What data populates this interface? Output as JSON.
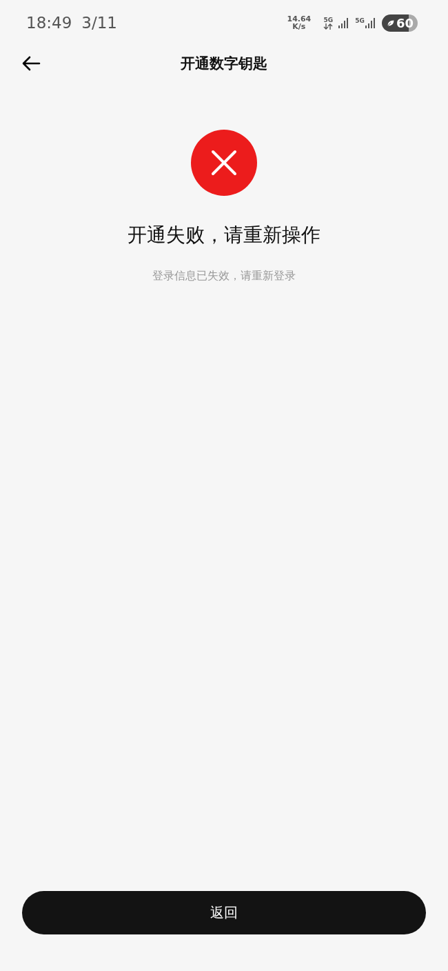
{
  "status_bar": {
    "time": "18:49",
    "date": "3/11",
    "net_speed": "14.64",
    "net_speed_unit": "K/s",
    "network_1": "5G",
    "network_2": "5G",
    "battery": "60"
  },
  "header": {
    "title": "开通数字钥匙"
  },
  "result": {
    "kind": "error",
    "title": "开通失败，请重新操作",
    "message": "登录信息已失效，请重新登录"
  },
  "button": {
    "label": "返回"
  }
}
